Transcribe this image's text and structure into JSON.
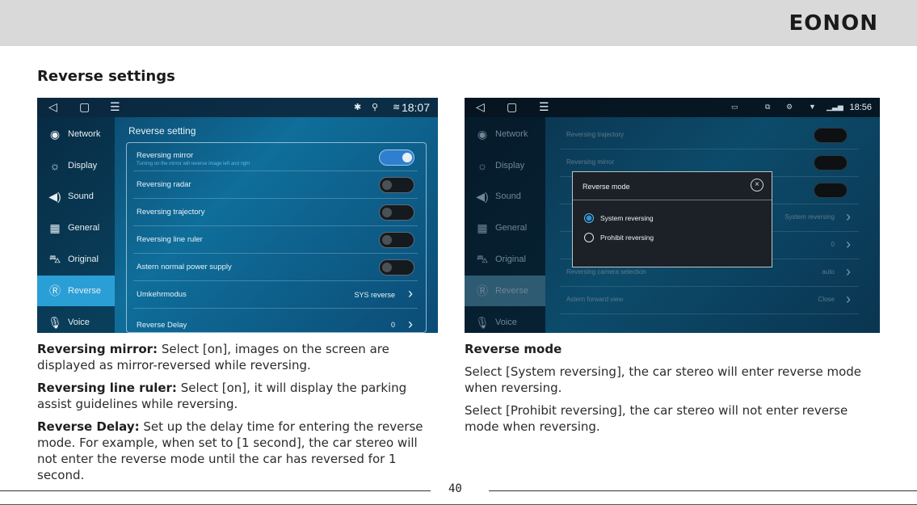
{
  "brand": {
    "logo_text": "EONON"
  },
  "section_title": "Reverse settings",
  "left_screen": {
    "status_time": "18:07",
    "sidebar": [
      {
        "label": "Network",
        "icon": "network-icon",
        "active": false
      },
      {
        "label": "Display",
        "icon": "display-icon",
        "active": false
      },
      {
        "label": "Sound",
        "icon": "sound-icon",
        "active": false
      },
      {
        "label": "General",
        "icon": "general-icon",
        "active": false
      },
      {
        "label": "Original",
        "icon": "car-icon",
        "active": false
      },
      {
        "label": "Reverse",
        "icon": "reverse-icon",
        "active": true
      },
      {
        "label": "Voice",
        "icon": "microphone-icon",
        "active": false
      }
    ],
    "panel_title": "Reverse setting",
    "rows": [
      {
        "label": "Reversing mirror",
        "sublabel": "Turning on the mirror will reverse image left and right",
        "toggle": true
      },
      {
        "label": "Reversing radar",
        "toggle": false
      },
      {
        "label": "Reversing trajectory",
        "toggle": false
      },
      {
        "label": "Reversing line ruler",
        "toggle": false
      },
      {
        "label": "Astern normal power supply",
        "toggle": false
      },
      {
        "label": "Umkehrmodus",
        "value": "SYS reverse"
      },
      {
        "label": "Reverse Delay",
        "value": "0"
      }
    ]
  },
  "right_screen": {
    "status_time": "18:56",
    "sidebar": [
      {
        "label": "Network",
        "icon": "network-icon",
        "active": false
      },
      {
        "label": "Display",
        "icon": "display-icon",
        "active": false
      },
      {
        "label": "Sound",
        "icon": "sound-icon",
        "active": false
      },
      {
        "label": "General",
        "icon": "general-icon",
        "active": false
      },
      {
        "label": "Original",
        "icon": "car-icon",
        "active": false
      },
      {
        "label": "Reverse",
        "icon": "reverse-icon",
        "active": true
      },
      {
        "label": "Voice",
        "icon": "microphone-icon",
        "active": false
      }
    ],
    "rows": [
      {
        "label": "Reversing trajectory",
        "kind": "toggle"
      },
      {
        "label": "Reversing mirror",
        "kind": "toggle"
      },
      {
        "label": "",
        "kind": "toggle"
      },
      {
        "label": "",
        "kind": "value",
        "value": "System reversing"
      },
      {
        "label": "",
        "kind": "value",
        "value": "0"
      },
      {
        "label": "Reversing camera selection",
        "kind": "value",
        "value": "auto"
      },
      {
        "label": "Astern forward view",
        "kind": "value",
        "value": "Close"
      }
    ],
    "dialog": {
      "title": "Reverse mode",
      "options": [
        {
          "label": "System reversing",
          "selected": true
        },
        {
          "label": "Prohibit reversing",
          "selected": false
        }
      ]
    }
  },
  "left_text": [
    {
      "term": "Reversing mirror:",
      "text": " Select [on], images on the screen are displayed as mirror-reversed while reversing."
    },
    {
      "term": "Reversing line ruler:",
      "text": " Select [on], it will display the parking assist guidelines while reversing."
    },
    {
      "term": "Reverse Delay:",
      "text": " Set up the delay time for entering the reverse mode. For example, when set to [1 second], the car stereo will not enter the reverse mode until the car has reversed for 1 second."
    }
  ],
  "right_text": {
    "heading": "Reverse mode",
    "paragraphs": [
      "Select [System reversing], the car stereo will enter reverse mode when reversing.",
      "Select [Prohibit reversing], the car stereo will not enter reverse mode when reversing."
    ]
  },
  "page_number": "40"
}
